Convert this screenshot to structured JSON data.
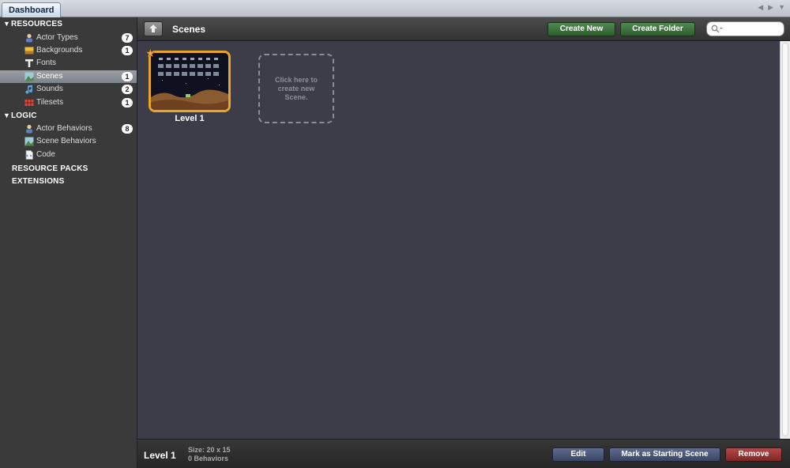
{
  "tabs": {
    "active": "Dashboard"
  },
  "sidebar": {
    "resources_header": "RESOURCES",
    "resources": [
      {
        "label": "Actor Types",
        "count": "7",
        "icon": "actor-icon"
      },
      {
        "label": "Backgrounds",
        "count": "1",
        "icon": "background-icon"
      },
      {
        "label": "Fonts",
        "count": "",
        "icon": "font-icon"
      },
      {
        "label": "Scenes",
        "count": "1",
        "icon": "scene-icon",
        "selected": true
      },
      {
        "label": "Sounds",
        "count": "2",
        "icon": "music-note-icon"
      },
      {
        "label": "Tilesets",
        "count": "1",
        "icon": "tileset-icon"
      }
    ],
    "logic_header": "LOGIC",
    "logic": [
      {
        "label": "Actor Behaviors",
        "count": "8",
        "icon": "actor-icon"
      },
      {
        "label": "Scene Behaviors",
        "count": "",
        "icon": "scene-icon"
      },
      {
        "label": "Code",
        "count": "",
        "icon": "code-file-icon"
      }
    ],
    "resource_packs": "RESOURCE PACKS",
    "extensions": "EXTENSIONS"
  },
  "header": {
    "title": "Scenes",
    "create_new": "Create New",
    "create_folder": "Create Folder",
    "search_placeholder": ""
  },
  "scenes": [
    {
      "name": "Level 1",
      "starting": true
    }
  ],
  "new_scene_placeholder": "Click here to create new Scene.",
  "footer": {
    "selected_name": "Level 1",
    "size": "Size: 20 x 15",
    "behaviors": "0 Behaviors",
    "edit": "Edit",
    "mark_starting": "Mark as Starting Scene",
    "remove": "Remove"
  },
  "colors": {
    "accent_green": "#3e763e",
    "thumb_border": "#e8a628",
    "remove_red": "#9a3535",
    "selected_row": "#8a9096"
  }
}
